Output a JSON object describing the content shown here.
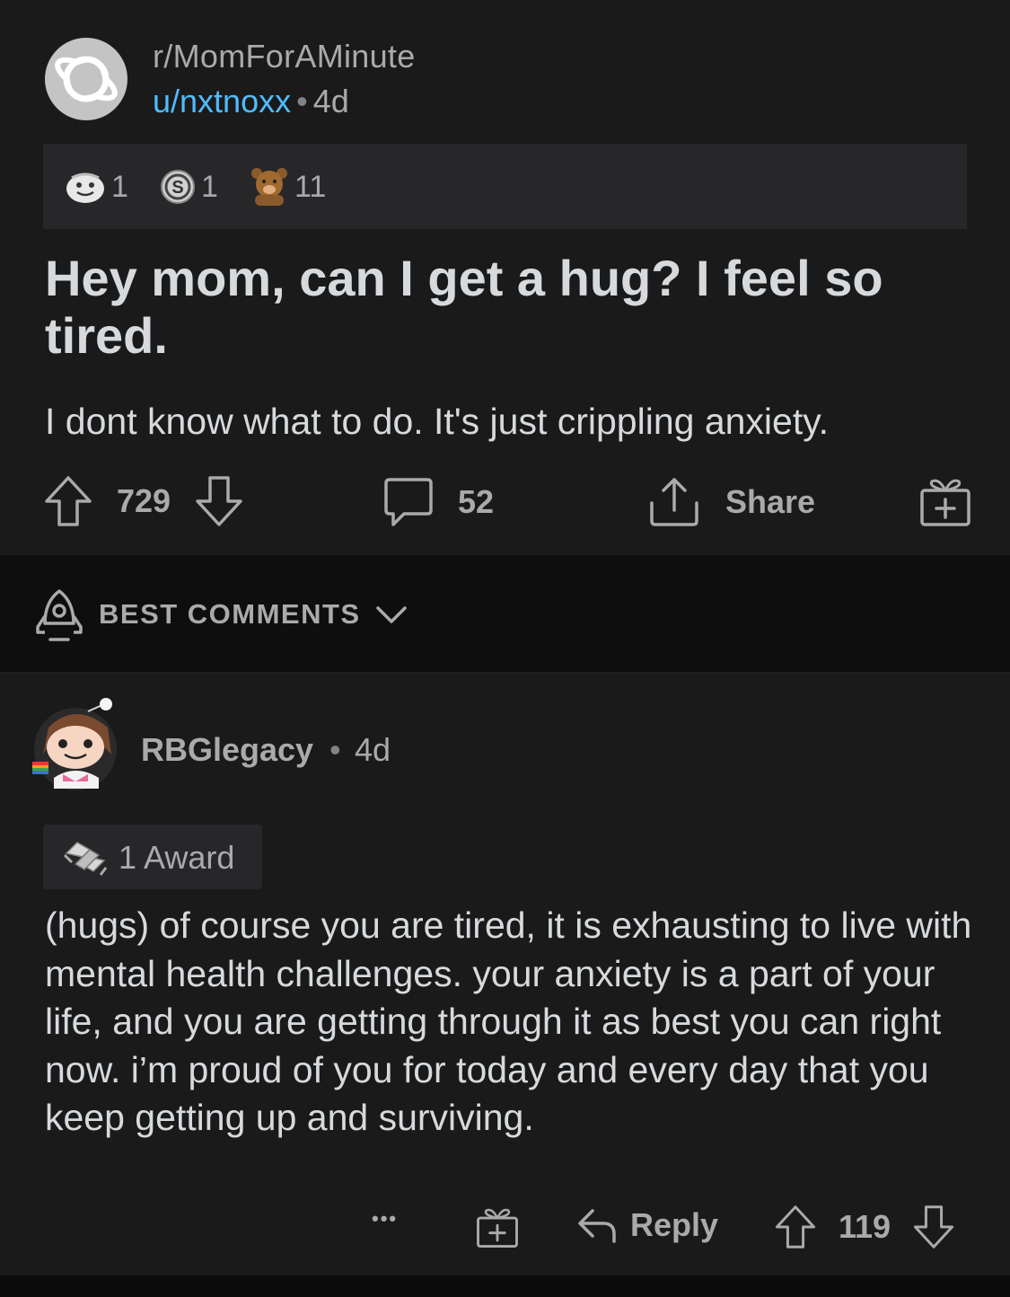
{
  "post": {
    "subreddit": "r/MomForAMinute",
    "author": "u/nxtnoxx",
    "separator": "•",
    "age": "4d",
    "awards": [
      {
        "icon": "wholesome-award-icon",
        "count": "1"
      },
      {
        "icon": "silver-coin-award-icon",
        "count": "1"
      },
      {
        "icon": "bear-hug-award-icon",
        "count": "11"
      }
    ],
    "title": "Hey mom, can I get a hug? I feel so tired.",
    "body": "I dont know what to do. It's just crippling anxiety.",
    "votes": "729",
    "comments": "52",
    "share_label": "Share"
  },
  "sort": {
    "label": "BEST COMMENTS"
  },
  "comment": {
    "author": "RBGlegacy",
    "separator": "•",
    "age": "4d",
    "award_label": "1 Award",
    "body": "(hugs) of course you are tired, it is exhausting to live with mental health challenges. your anxiety is a part of your life, and you are getting through it as best you can right now. i’m proud of you for today and every day that you keep getting up and surviving.",
    "more_label": "•••",
    "reply_label": "Reply",
    "votes": "119"
  },
  "colors": {
    "background": "#1a1a1b",
    "accent_link": "#4fbcff",
    "muted_text": "#a8aaab",
    "primary_text": "#d7dadc"
  }
}
